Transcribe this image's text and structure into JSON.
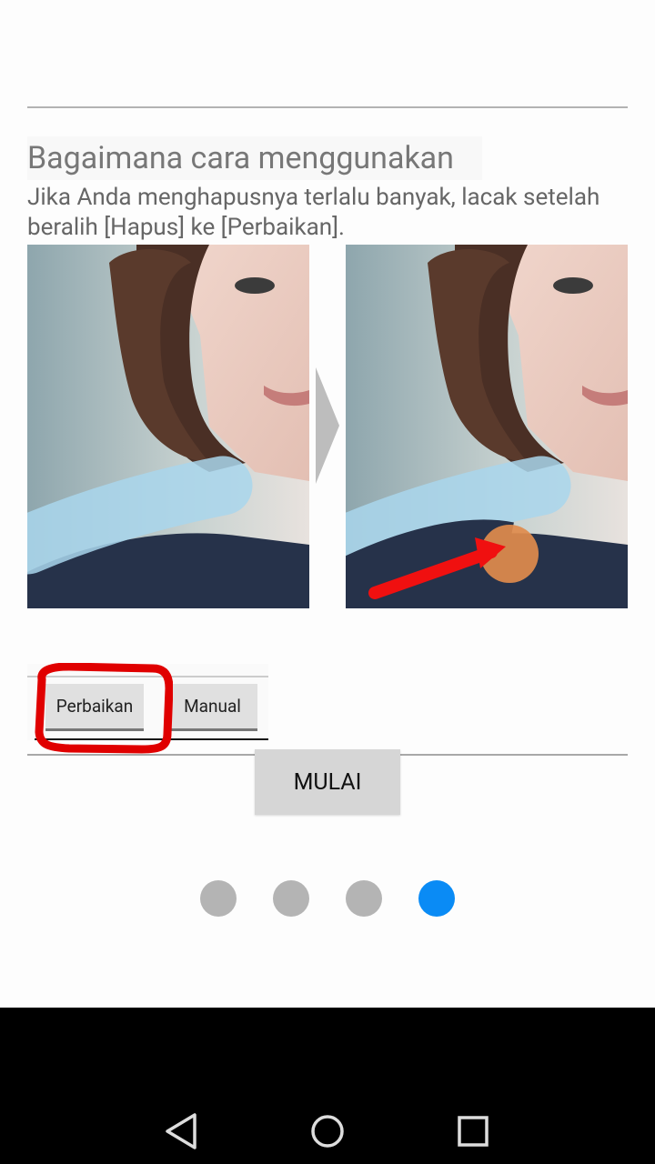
{
  "page": {
    "title": "Bagaimana cara menggunakan",
    "description": "Jika Anda menghapusnya terlalu banyak, lacak setelah beralih [Hapus] ke [Perbaikan]."
  },
  "illustration": {
    "before_image": "portrait-before",
    "after_image": "portrait-after",
    "separator_icon": "chevron-right-icon"
  },
  "tabs": [
    {
      "label": "Perbaikan",
      "selected": true
    },
    {
      "label": "Manual",
      "selected": false
    }
  ],
  "start_button": {
    "label": "MULAI"
  },
  "pager": {
    "count": 4,
    "active_index": 3
  },
  "navbar": {
    "icons": [
      "back-icon",
      "home-icon",
      "recents-icon"
    ]
  },
  "colors": {
    "accent": "#0a8bf5",
    "dot_inactive": "#b4b4b4",
    "highlight_mark": "#e00000",
    "mask_stroke": "#a9d6ec"
  }
}
